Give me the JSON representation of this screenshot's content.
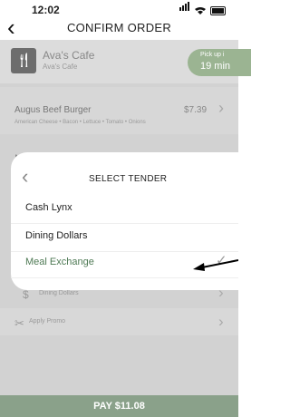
{
  "status": {
    "time": "12:02"
  },
  "header": {
    "back_icon": "chevron-left-icon",
    "title": "CONFIRM ORDER"
  },
  "cafe": {
    "name": "Ava's Cafe",
    "subtitle": "Ava's Cafe",
    "pickup_label": "Pick up i",
    "pickup_value": "19 min"
  },
  "order_item": {
    "name": "Augus Beef Burger",
    "price": "$7.39",
    "description": "American Cheese • Bacon • Lettuce • Tomato • Onions"
  },
  "partial_text": "N",
  "payment": {
    "tender_label": "Dining Dollars",
    "promo_label": "Apply Promo"
  },
  "modal": {
    "title": "SELECT TENDER",
    "options": [
      {
        "label": "Cash Lynx",
        "selected": false
      },
      {
        "label": "Dining Dollars",
        "selected": false
      },
      {
        "label": "Meal Exchange",
        "selected": true
      }
    ]
  },
  "pay_button": {
    "label": "PAY $11.08"
  },
  "colors": {
    "accent_green": "#8aa18a",
    "pickup_green": "#9bb492",
    "selected_text": "#4f7a55"
  }
}
